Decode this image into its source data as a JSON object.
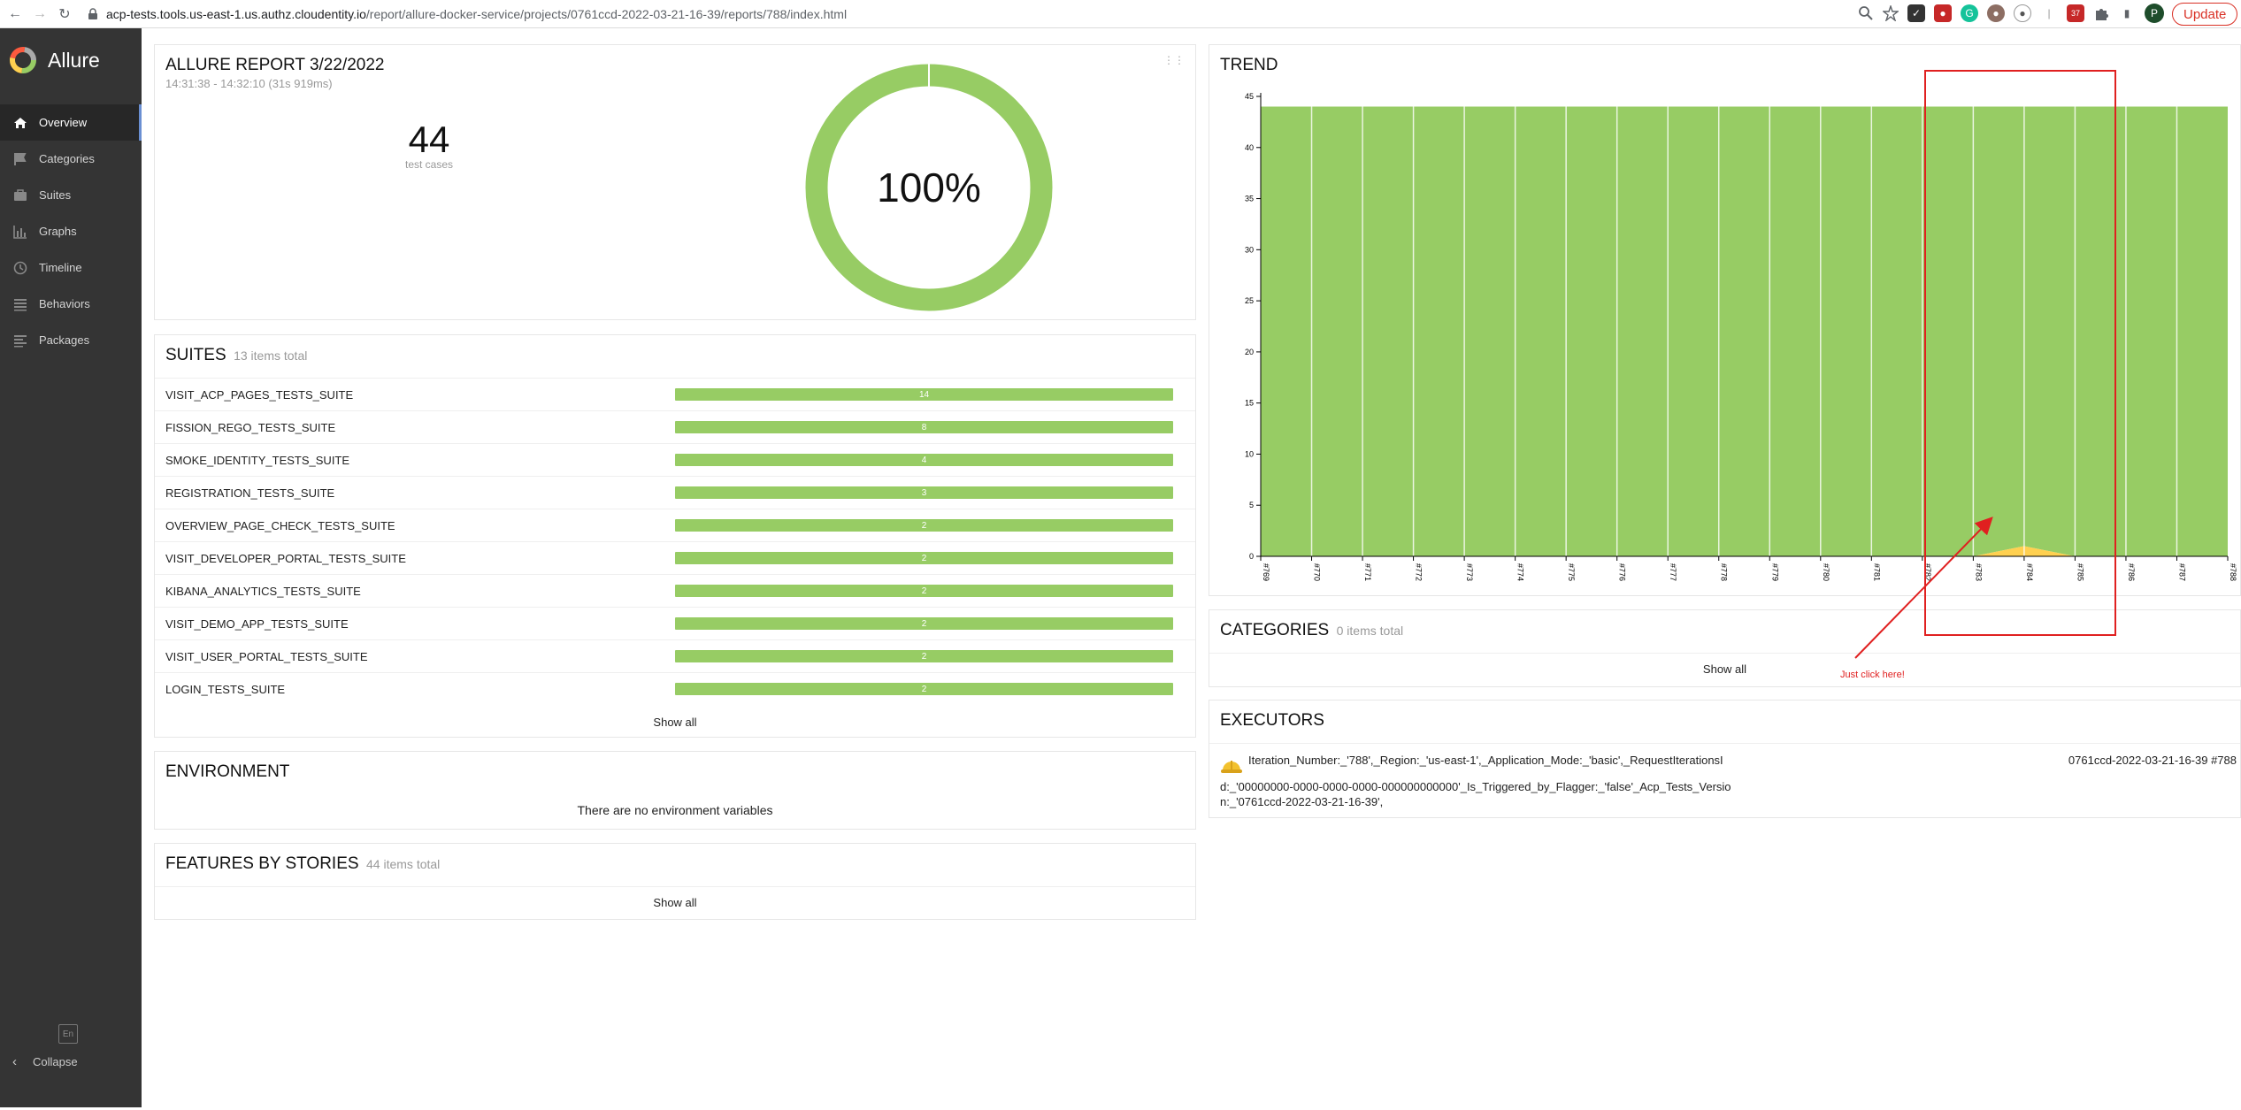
{
  "browser": {
    "url_host": "acp-tests.tools.us-east-1.us.authz.cloudentity.io",
    "url_path": "/report/allure-docker-service/projects/0761ccd-2022-03-21-16-39/reports/788/index.html",
    "update_label": "Update",
    "profile_initial": "P",
    "ext_badge": "37"
  },
  "sidebar": {
    "brand": "Allure",
    "items": [
      {
        "label": "Overview",
        "icon": "home-icon"
      },
      {
        "label": "Categories",
        "icon": "flag-icon"
      },
      {
        "label": "Suites",
        "icon": "briefcase-icon"
      },
      {
        "label": "Graphs",
        "icon": "bar-chart-icon"
      },
      {
        "label": "Timeline",
        "icon": "clock-icon"
      },
      {
        "label": "Behaviors",
        "icon": "list-icon"
      },
      {
        "label": "Packages",
        "icon": "align-left-icon"
      }
    ],
    "lang": "En",
    "collapse_label": "Collapse"
  },
  "summary": {
    "title": "ALLURE REPORT 3/22/2022",
    "time": "14:31:38 - 14:32:10 (31s 919ms)",
    "count": "44",
    "count_label": "test cases",
    "percent": "100%"
  },
  "suites": {
    "title": "SUITES",
    "subtitle": "13 items total",
    "rows": [
      {
        "name": "VISIT_ACP_PAGES_TESTS_SUITE",
        "count": "14"
      },
      {
        "name": "FISSION_REGO_TESTS_SUITE",
        "count": "8"
      },
      {
        "name": "SMOKE_IDENTITY_TESTS_SUITE",
        "count": "4"
      },
      {
        "name": "REGISTRATION_TESTS_SUITE",
        "count": "3"
      },
      {
        "name": "OVERVIEW_PAGE_CHECK_TESTS_SUITE",
        "count": "2"
      },
      {
        "name": "VISIT_DEVELOPER_PORTAL_TESTS_SUITE",
        "count": "2"
      },
      {
        "name": "KIBANA_ANALYTICS_TESTS_SUITE",
        "count": "2"
      },
      {
        "name": "VISIT_DEMO_APP_TESTS_SUITE",
        "count": "2"
      },
      {
        "name": "VISIT_USER_PORTAL_TESTS_SUITE",
        "count": "2"
      },
      {
        "name": "LOGIN_TESTS_SUITE",
        "count": "2"
      }
    ],
    "show_all": "Show all"
  },
  "environment": {
    "title": "ENVIRONMENT",
    "empty": "There are no environment variables"
  },
  "features": {
    "title": "FEATURES BY STORIES",
    "subtitle": "44 items total",
    "show_all": "Show all"
  },
  "trend": {
    "title": "TREND",
    "annotation": "Just click here!"
  },
  "categories": {
    "title": "CATEGORIES",
    "subtitle": "0 items total",
    "show_all": "Show all"
  },
  "executors": {
    "title": "EXECUTORS",
    "line1": "Iteration_Number:_'788',_Region:_'us-east-1',_Application_Mode:_'basic',_RequestIterationsI",
    "line2": "d:_'00000000-0000-0000-0000-000000000000'_Is_Triggered_by_Flagger:_'false'_Acp_Tests_Versio",
    "line3": "n:_'0761ccd-2022-03-21-16-39',",
    "build": "0761ccd-2022-03-21-16-39 #788"
  },
  "chart_data": {
    "type": "area",
    "title": "TREND",
    "x": [
      "#769",
      "#770",
      "#771",
      "#772",
      "#773",
      "#774",
      "#775",
      "#776",
      "#777",
      "#778",
      "#779",
      "#780",
      "#781",
      "#782",
      "#783",
      "#784",
      "#785",
      "#786",
      "#787",
      "#788"
    ],
    "series": [
      {
        "name": "passed",
        "color": "#97cc64",
        "values": [
          44,
          44,
          44,
          44,
          44,
          44,
          44,
          44,
          44,
          44,
          44,
          44,
          44,
          44,
          44,
          43,
          44,
          44,
          44,
          44
        ]
      },
      {
        "name": "broken",
        "color": "#ffd050",
        "values": [
          0,
          0,
          0,
          0,
          0,
          0,
          0,
          0,
          0,
          0,
          0,
          0,
          0,
          0,
          0,
          1,
          0,
          0,
          0,
          0
        ]
      }
    ],
    "ylim": [
      0,
      45
    ],
    "yticks": [
      0,
      5,
      10,
      15,
      20,
      25,
      30,
      35,
      40,
      45
    ],
    "grid": false
  }
}
